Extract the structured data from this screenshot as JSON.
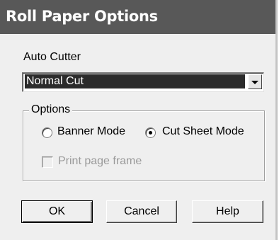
{
  "dialog": {
    "title": "Roll Paper Options"
  },
  "auto_cutter": {
    "label": "Auto Cutter",
    "selected": "Normal Cut"
  },
  "options": {
    "legend": "Options",
    "banner_mode_label": "Banner Mode",
    "banner_mode_checked": false,
    "cut_sheet_mode_label": "Cut Sheet Mode",
    "cut_sheet_mode_checked": true,
    "print_page_frame_label": "Print page frame",
    "print_page_frame_checked": false,
    "print_page_frame_enabled": false
  },
  "buttons": {
    "ok": "OK",
    "cancel": "Cancel",
    "help": "Help"
  }
}
